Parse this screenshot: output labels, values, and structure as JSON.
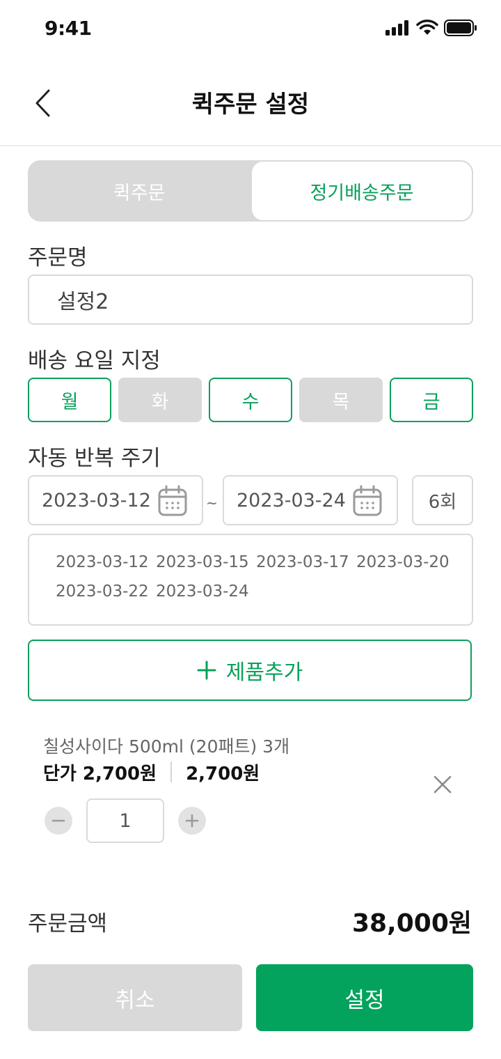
{
  "status_bar": {
    "time": "9:41",
    "icons": [
      "signal-icon",
      "wifi-icon",
      "battery-icon"
    ]
  },
  "header": {
    "title": "퀵주문 설정",
    "back_icon": "chevron-left-icon"
  },
  "order_type_tabs": [
    {
      "label": "퀵주문",
      "selected": false
    },
    {
      "label": "정기배송주문",
      "selected": true
    }
  ],
  "order_name": {
    "label": "주문명",
    "value": "설정2"
  },
  "delivery_days": {
    "label": "배송 요일 지정",
    "days": [
      {
        "label": "월",
        "selected": true
      },
      {
        "label": "화",
        "selected": false
      },
      {
        "label": "수",
        "selected": true
      },
      {
        "label": "목",
        "selected": false
      },
      {
        "label": "금",
        "selected": true
      }
    ]
  },
  "repeat": {
    "label": "자동 반복 주기",
    "start_date": "2023-03-12",
    "separator": "~",
    "end_date": "2023-03-24",
    "count": "6회",
    "dates": [
      "2023-03-12",
      "2023-03-15",
      "2023-03-17",
      "2023-03-20",
      "2023-03-22",
      "2023-03-24"
    ]
  },
  "add_product": {
    "label": "제품추가",
    "icon": "plus-icon"
  },
  "product": {
    "name": "칠성사이다 500ml (20패트) 3개",
    "unit_price": "단가 2,700원",
    "subtotal": "2,700원",
    "quantity": "1"
  },
  "total": {
    "label": "주문금액",
    "value": "38,000원"
  },
  "actions": {
    "cancel": "취소",
    "confirm": "설정"
  },
  "colors": {
    "accent": "#09a05a",
    "confirm_bg": "#03a35e",
    "disabled": "#d9d9d9",
    "border": "#dadada"
  }
}
